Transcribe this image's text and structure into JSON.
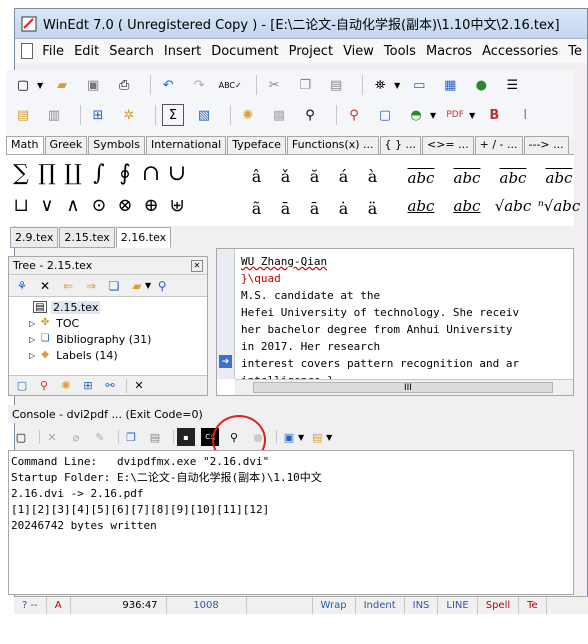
{
  "window": {
    "title": "WinEdt 7.0  ( Unregistered  Copy )  - [E:\\二论文-自动化学报(副本)\\1.10中文\\2.16.tex]"
  },
  "menu": [
    "File",
    "Edit",
    "Search",
    "Insert",
    "Document",
    "Project",
    "View",
    "Tools",
    "Macros",
    "Accessories",
    "Te"
  ],
  "symbol_tabs": [
    "Math",
    "Greek",
    "Symbols",
    "International",
    "Typeface",
    "Functions(x) ...",
    "{ } ...",
    "<>= ...",
    "+ / - ...",
    "---> ..."
  ],
  "symbols_row1": [
    "∑",
    "∏",
    "∐",
    "∫",
    "∮",
    "∩",
    "∪"
  ],
  "symbols_row2": [
    "⊔",
    "∨",
    "∧",
    "⊙",
    "⊗",
    "⊕",
    "⊎"
  ],
  "accents_row1": [
    "â",
    "ǎ",
    "ă",
    "á",
    "à"
  ],
  "accents_row2": [
    "ã",
    "ā",
    "ā",
    "ȧ",
    "ä"
  ],
  "wide_row1": [
    "abc",
    "abc",
    "abc",
    "abc"
  ],
  "wide_row2": [
    "abc",
    "abc",
    "√abc",
    "ⁿ√abc"
  ],
  "doc_tabs": [
    "2.9.tex",
    "2.15.tex",
    "2.16.tex"
  ],
  "tree": {
    "title": "Tree - 2.15.tex",
    "root": "2.15.tex",
    "items": [
      "TOC",
      "Bibliography  (31)",
      "Labels  (14)"
    ]
  },
  "editor_lines": [
    "WU Zhang-Qian",
    "}\\quad",
    "M.S. candidate at the",
    "Hefei University of technology. She receiv",
    "her bachelor degree from Anhui University",
    "in 2017. Her research",
    "interest covers pattern recognition and ar",
    "intelligence.}"
  ],
  "scroll_grip": "III",
  "console": {
    "header": "Console - dvi2pdf ... (Exit Code=0)",
    "lines": [
      "Command Line:   dvipdfmx.exe \"2.16.dvi\"",
      "Startup Folder: E:\\二论文-自动化学报(副本)\\1.10中文",
      "",
      "2.16.dvi -> 2.16.pdf",
      "[1][2][3][4][5][6][7][8][9][10][11][12]",
      "20246742 bytes written"
    ]
  },
  "status": {
    "help": "? --",
    "mode": "A",
    "pos": "936:47",
    "lines": "1008",
    "wrap": "Wrap",
    "indent": "Indent",
    "ins": "INS",
    "line": "LINE",
    "spell": "Spell",
    "te": "Te"
  },
  "colors": {
    "accent_red": "#e02020",
    "status_blue": "#2b5aa5"
  }
}
